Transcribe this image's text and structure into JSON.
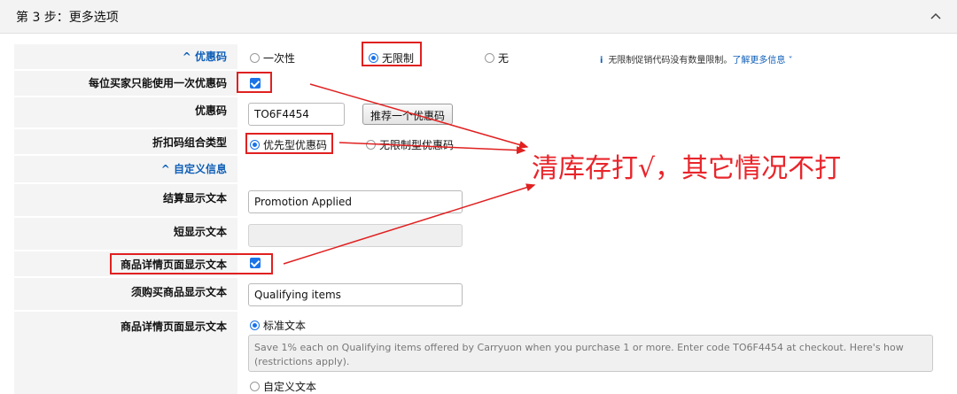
{
  "header": {
    "title": "第 3 步：更多选项"
  },
  "rows": {
    "coupon_type": {
      "label": "^ 优惠码",
      "options": [
        "一次性",
        "无限制",
        "无"
      ],
      "selected": "无限制"
    },
    "info": {
      "icon_text": "i",
      "text": "无限制促销代码没有数量限制。",
      "link": "了解更多信息"
    },
    "one_per_buyer": {
      "label": "每位买家只能使用一次优惠码",
      "checked": true
    },
    "code": {
      "label": "优惠码",
      "value": "TO6F4454",
      "suggest_button": "推荐一个优惠码"
    },
    "combine": {
      "label": "折扣码组合类型",
      "options": [
        "优先型优惠码",
        "无限制型优惠码"
      ],
      "selected": "优先型优惠码"
    },
    "custom_info": {
      "label": "^ 自定义信息"
    },
    "checkout_text": {
      "label": "结算显示文本",
      "value": "Promotion Applied"
    },
    "short_text": {
      "label": "短显示文本",
      "value": ""
    },
    "detail_page_text": {
      "label": "商品详情页面显示文本",
      "checked": true
    },
    "qualifying_text": {
      "label": "须购买商品显示文本",
      "value": "Qualifying items"
    },
    "detail_page_text2": {
      "label": "商品详情页面显示文本",
      "options": [
        "标准文本",
        "自定义文本"
      ],
      "selected": "标准文本",
      "standard_text": "Save 1% each on Qualifying items offered by Carryuon when you purchase 1 or more. Enter code TO6F4454 at checkout. Here's how (restrictions apply)."
    }
  },
  "annotation": {
    "text": "清库存打√，其它情况不打",
    "color": "#e8252b"
  },
  "colors": {
    "accent": "#1a73e8",
    "link": "#0f5fb8",
    "highlight": "#e02020",
    "label_bg": "#f4f4f4"
  }
}
